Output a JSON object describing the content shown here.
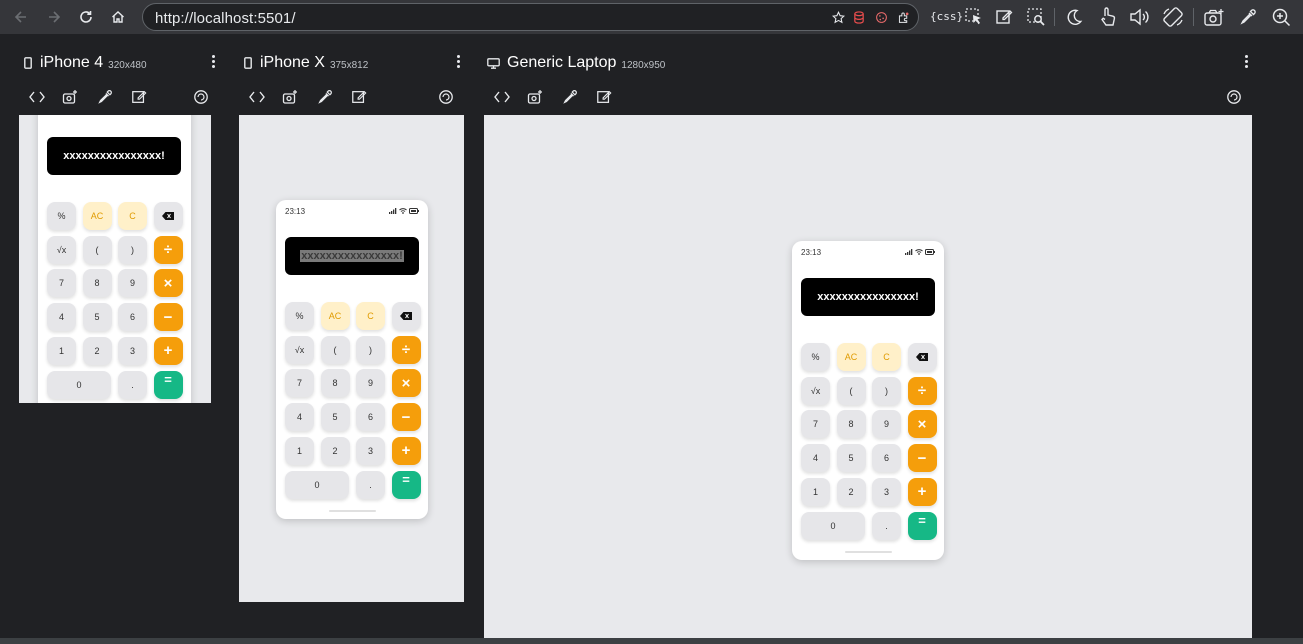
{
  "browser": {
    "url": "http://localhost:5501/",
    "extension_label": "{css}"
  },
  "panes": [
    {
      "title": "iPhone 4",
      "dims": "320x480"
    },
    {
      "title": "iPhone X",
      "dims": "375x812"
    },
    {
      "title": "Generic Laptop",
      "dims": "1280x950"
    }
  ],
  "calculator": {
    "time": "23:13",
    "display": "xxxxxxxxxxxxxxxx!",
    "keys": [
      "%",
      "AC",
      "C",
      "⌫",
      "√x",
      "(",
      ")",
      "÷",
      "7",
      "8",
      "9",
      "×",
      "4",
      "5",
      "6",
      "−",
      "1",
      "2",
      "3",
      "+",
      "0",
      ".",
      "="
    ]
  },
  "colors": {
    "accent_orange": "#f59e0b",
    "accent_green": "#16b886",
    "clear_yellow": "#fff0c9",
    "key_gray": "#e6e6e9",
    "display_black": "#000000"
  }
}
